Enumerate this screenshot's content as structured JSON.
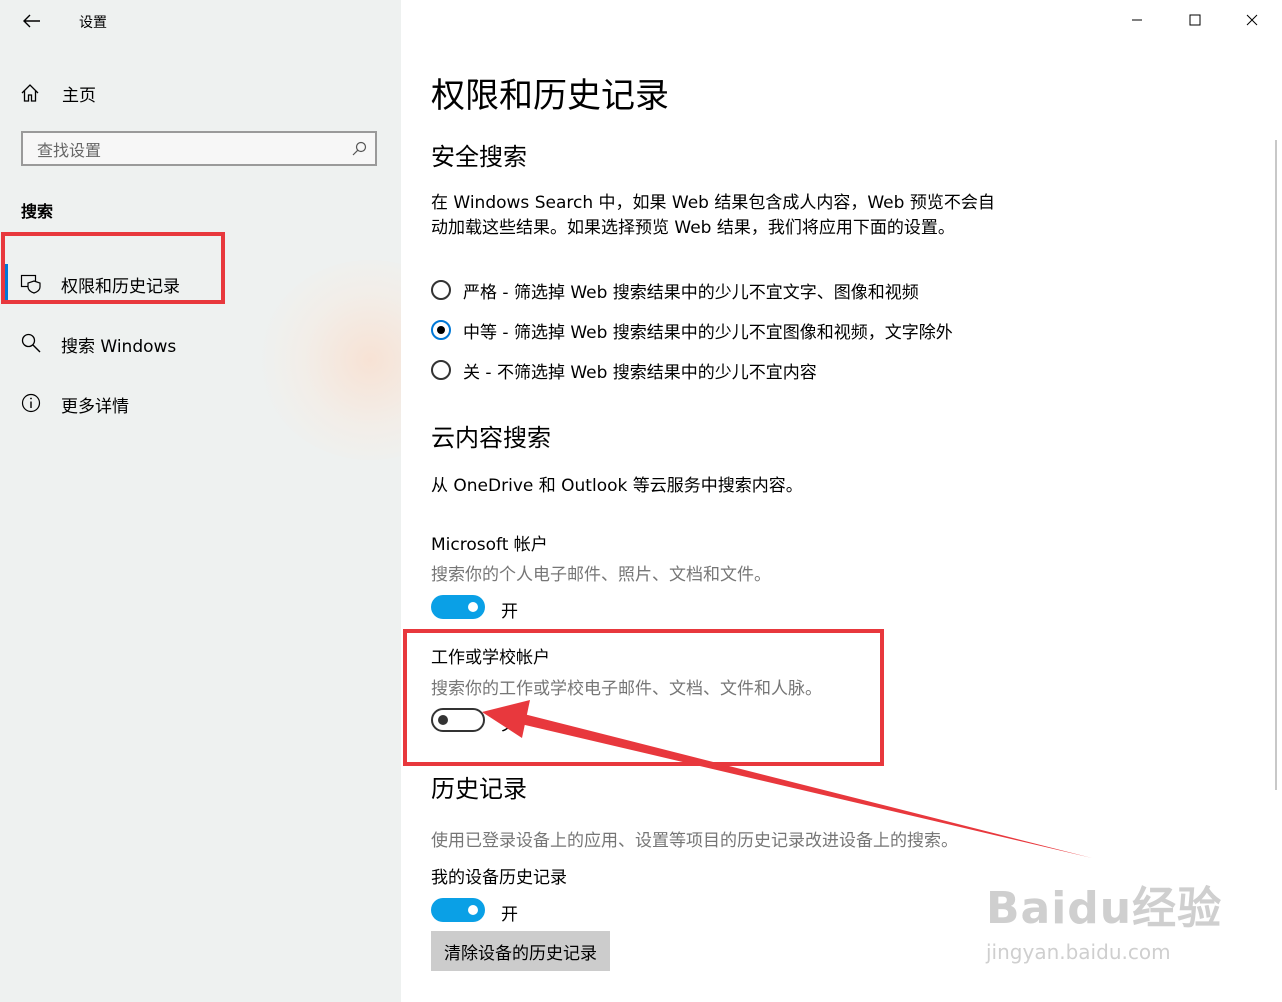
{
  "window": {
    "app_title": "设置",
    "minimize_icon": "minimize-icon",
    "maximize_icon": "maximize-icon",
    "close_icon": "close-icon"
  },
  "sidebar": {
    "home_label": "主页",
    "search_placeholder": "查找设置",
    "section_label": "搜索",
    "items": [
      {
        "label": "权限和历史记录",
        "icon": "shield-icon",
        "active": true
      },
      {
        "label": "搜索 Windows",
        "icon": "search-icon",
        "active": false
      },
      {
        "label": "更多详情",
        "icon": "info-icon",
        "active": false
      }
    ]
  },
  "main": {
    "page_title": "权限和历史记录",
    "safe_search": {
      "heading": "安全搜索",
      "description": "在 Windows Search 中，如果 Web 结果包含成人内容，Web 预览不会自动加载这些结果。如果选择预览 Web 结果，我们将应用下面的设置。",
      "options": [
        {
          "label": "严格 - 筛选掉 Web 搜索结果中的少儿不宜文字、图像和视频",
          "checked": false
        },
        {
          "label": "中等 - 筛选掉 Web 搜索结果中的少儿不宜图像和视频，文字除外",
          "checked": true
        },
        {
          "label": "关 - 不筛选掉 Web 搜索结果中的少儿不宜内容",
          "checked": false
        }
      ]
    },
    "cloud_search": {
      "heading": "云内容搜索",
      "description": "从 OneDrive 和 Outlook 等云服务中搜索内容。",
      "microsoft_account": {
        "title": "Microsoft 帐户",
        "description": "搜索你的个人电子邮件、照片、文档和文件。",
        "state_label": "开",
        "on": true
      },
      "work_school_account": {
        "title": "工作或学校帐户",
        "description": "搜索你的工作或学校电子邮件、文档、文件和人脉。",
        "state_label": "关",
        "on": false
      }
    },
    "history": {
      "heading": "历史记录",
      "description": "使用已登录设备上的应用、设置等项目的历史记录改进设备上的搜索。",
      "device_history": {
        "title": "我的设备历史记录",
        "state_label": "开",
        "on": true
      },
      "clear_button": "清除设备的历史记录"
    }
  },
  "watermark": {
    "brand": "Baidu经验",
    "url": "jingyan.baidu.com"
  },
  "colors": {
    "accent": "#0078d7",
    "toggle_on": "#0aa0e6",
    "annotation_red": "#e8383d",
    "sidebar_bg": "#eef1f0"
  }
}
